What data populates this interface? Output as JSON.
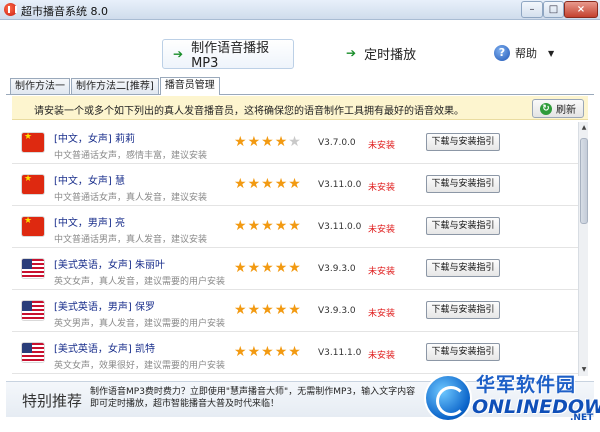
{
  "window": {
    "title": "超市播音系统 8.0",
    "minimize": "–",
    "maximize": "□",
    "close": "×"
  },
  "toolbar": {
    "make_mp3": "制作语音播报MP3",
    "timer": "定时播放",
    "help": "帮助",
    "help_icon": "?",
    "arrow": "➔",
    "caret": "▼"
  },
  "tabs": [
    {
      "label": "制作方法一",
      "active": false
    },
    {
      "label": "制作方法二[推荐]",
      "active": false
    },
    {
      "label": "播音员管理",
      "active": true
    }
  ],
  "info": {
    "text": "请安装一个或多个如下列出的真人发音播音员，这将确保您的语音制作工具拥有最好的语音效果。",
    "refresh": "刷新",
    "refresh_icon": "↻"
  },
  "voices": [
    {
      "name": "[中文，女声] 莉莉",
      "desc": "中文普通话女声，感情丰富，建议安装",
      "flag": "cn",
      "rating": 4,
      "version": "V3.7.0.0",
      "status": "未安装",
      "button": "下载与安装指引"
    },
    {
      "name": "[中文，女声] 慧",
      "desc": "中文普通话女声，真人发音，建议安装",
      "flag": "cn",
      "rating": 5,
      "version": "V3.11.0.0",
      "status": "未安装",
      "button": "下载与安装指引"
    },
    {
      "name": "[中文，男声] 亮",
      "desc": "中文普通话男声，真人发音，建议安装",
      "flag": "cn",
      "rating": 5,
      "version": "V3.11.0.0",
      "status": "未安装",
      "button": "下载与安装指引"
    },
    {
      "name": "[美式英语，女声] 朱丽叶",
      "desc": "英文女声，真人发音，建议需要的用户安装",
      "flag": "us",
      "rating": 5,
      "version": "V3.9.3.0",
      "status": "未安装",
      "button": "下载与安装指引"
    },
    {
      "name": "[美式英语，男声] 保罗",
      "desc": "英文男声，真人发音，建议需要的用户安装",
      "flag": "us",
      "rating": 5,
      "version": "V3.9.3.0",
      "status": "未安装",
      "button": "下载与安装指引"
    },
    {
      "name": "[美式英语，女声] 凯特",
      "desc": "英文女声，效果很好，建议需要的用户安装",
      "flag": "us",
      "rating": 5,
      "version": "V3.11.1.0",
      "status": "未安装",
      "button": "下载与安装指引"
    }
  ],
  "footer": {
    "title": "特别推荐",
    "text": "制作语音MP3费时费力？立即使用\"慧声播音大师\"，无需制作MP3，输入文字内容即可定时播放，超市智能播音大普及时代来临！"
  },
  "watermark": {
    "cn": "华军软件园",
    "en": "ONLINEDOWN",
    "com": ".NET"
  },
  "colors": {
    "status_red": "#e02020",
    "star_orange": "#f29a12",
    "name_blue": "#1a2f8c"
  }
}
